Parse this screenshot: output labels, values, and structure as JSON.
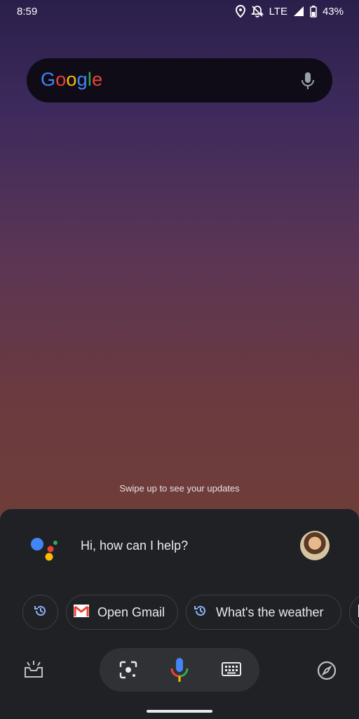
{
  "status_bar": {
    "time": "8:59",
    "network": "LTE",
    "battery": "43%"
  },
  "search_bar": {
    "logo_letters": [
      {
        "char": "G",
        "color": "#4285F4"
      },
      {
        "char": "o",
        "color": "#EA4335"
      },
      {
        "char": "o",
        "color": "#FBBC05"
      },
      {
        "char": "g",
        "color": "#4285F4"
      },
      {
        "char": "l",
        "color": "#34A853"
      },
      {
        "char": "e",
        "color": "#EA4335"
      }
    ],
    "mic_icon": "mic-icon"
  },
  "home": {
    "swipe_hint": "Swipe up to see your updates"
  },
  "assistant": {
    "greeting": "Hi, how can I help?",
    "chips": [
      {
        "icon": "history-icon",
        "label": ""
      },
      {
        "icon": "gmail-icon",
        "label": "Open Gmail"
      },
      {
        "icon": "history-icon",
        "label": "What's the weather"
      }
    ],
    "bottom_icons": [
      "updates-icon",
      "lens-icon",
      "mic-icon",
      "keyboard-icon",
      "explore-icon"
    ]
  },
  "colors": {
    "sheet_bg": "#202124",
    "chip_border": "#3c4043",
    "accent_blue": "#8ab4f8"
  }
}
